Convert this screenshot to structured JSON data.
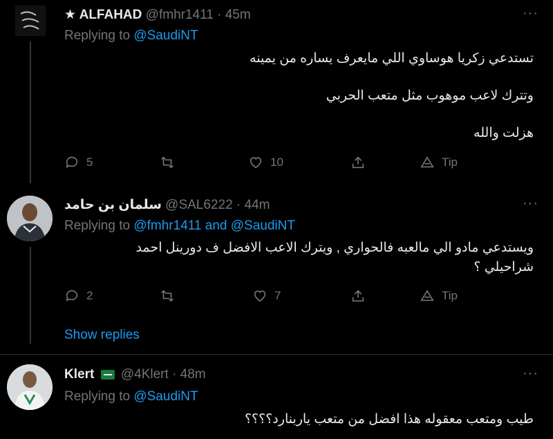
{
  "tweets": [
    {
      "name": "★ ALFAHAD",
      "handle": "@fmhr1411",
      "time": "45m",
      "replying_prefix": "Replying to ",
      "replying_to": "@SaudiNT",
      "lines": [
        "تستدعي زكريا هوساوي اللي مايعرف يساره من يمينه",
        "وتترك لاعب موهوب مثل متعب الحربي",
        "هزلت والله"
      ],
      "replies": "5",
      "retweets": "",
      "likes": "10",
      "tip": "Tip"
    },
    {
      "name": "سلمان بن حامد",
      "handle": "@SAL6222",
      "time": "44m",
      "replying_prefix": "Replying to ",
      "replying_to": "@fmhr1411 and @SaudiNT",
      "lines": [
        "ويستدعي مادو الي مالعبه فالحواري , ويترك الاعب الافضل ف دورينل احمد شراحيلي ؟"
      ],
      "replies": "2",
      "retweets": "",
      "likes": "7",
      "tip": "Tip"
    },
    {
      "name": "Klert",
      "handle": "@4Klert",
      "time": "48m",
      "replying_prefix": "Replying to ",
      "replying_to": "@SaudiNT",
      "lines": [
        "طيب ومتعب معقوله هذا افضل من متعب ياربنارد؟؟؟؟"
      ]
    }
  ],
  "separator": "·",
  "more": "···",
  "show_replies": "Show replies",
  "colors": {
    "background": "#000000",
    "link": "#1d9bf0",
    "muted": "#71767b"
  }
}
